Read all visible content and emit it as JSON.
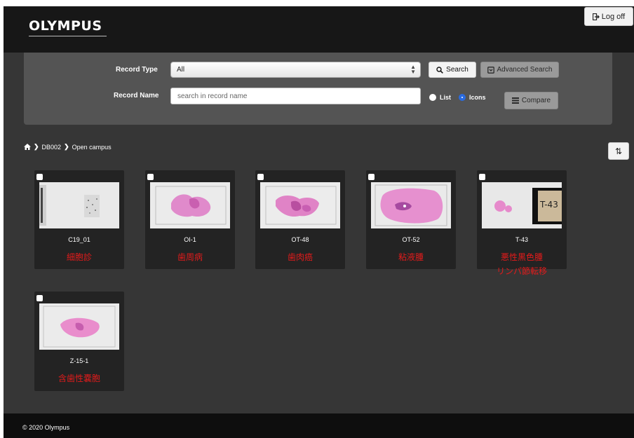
{
  "header": {
    "logo": "OLYMPUS",
    "logoff_label": "Log off"
  },
  "search": {
    "record_type_label": "Record Type",
    "record_type_value": "All",
    "record_name_label": "Record Name",
    "record_name_placeholder": "search in record name",
    "search_button": "Search",
    "advanced_button": "Advanced Search",
    "compare_button": "Compare",
    "view_list_label": "List",
    "view_icons_label": "Icons",
    "view_selected": "Icons"
  },
  "breadcrumb": {
    "db": "DB002",
    "folder": "Open campus"
  },
  "records": [
    {
      "name": "C19_01",
      "labels": [
        "細胞診"
      ]
    },
    {
      "name": "OI-1",
      "labels": [
        "歯周病"
      ]
    },
    {
      "name": "OT-48",
      "labels": [
        "歯肉癌"
      ]
    },
    {
      "name": "OT-52",
      "labels": [
        "粘液腫"
      ]
    },
    {
      "name": "T-43",
      "labels": [
        "悪性黒色腫",
        "リンパ節転移"
      ]
    },
    {
      "name": "Z-15-1",
      "labels": [
        "含歯性嚢胞"
      ]
    }
  ],
  "footer": {
    "copyright": "© 2020 Olympus"
  },
  "colors": {
    "header_bg": "#171717",
    "panel_bg": "#545454",
    "main_bg": "#363636",
    "label_red": "#e21b1b",
    "stain_pink": "#e27fc9"
  }
}
